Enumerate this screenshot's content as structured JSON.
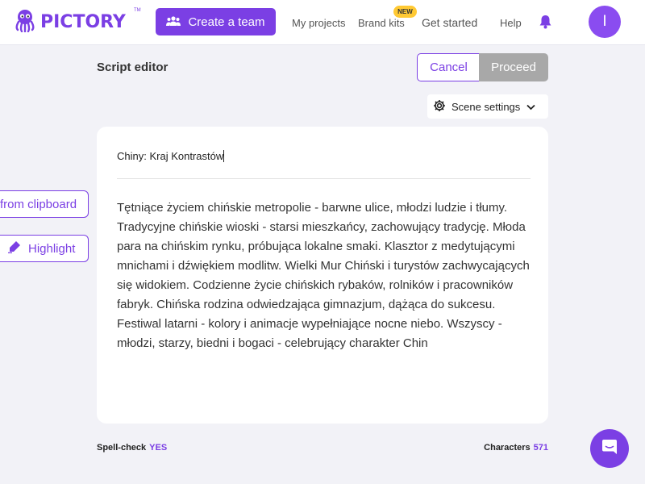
{
  "nav": {
    "logo_text": "PICTORY",
    "logo_tm": "TM",
    "create_team_label": "Create a team",
    "links": {
      "my_projects": "My projects",
      "brand_kits": "Brand kits",
      "get_started": "Get started",
      "help": "Help"
    },
    "new_badge": "NEW",
    "avatar_initial": "I"
  },
  "editor": {
    "page_title": "Script editor",
    "cancel_label": "Cancel",
    "proceed_label": "Proceed",
    "scene_settings_label": "Scene settings",
    "script_title": "Chiny: Kraj Kontrastów",
    "script_body": "Tętniące życiem chińskie metropolie - barwne ulice, młodzi ludzie i tłumy. Tradycyjne chińskie wioski - starsi mieszkańcy, zachowujący tradycję. Młoda para na chińskim rynku, próbująca lokalne smaki. Klasztor z medytującymi mnichami i dźwiękiem modlitw. Wielki Mur Chiński i turystów zachwycających się widokiem. Codzienne życie chińskich rybaków, rolników i pracowników fabryk. Chińska rodzina odwiedzająca gimnazjum, dążąca do sukcesu. Festiwal latarni - kolory i animacje wypełniające nocne niebo. Wszyscy - młodzi, starzy, biedni i bogaci - celebrujący charakter Chin"
  },
  "side": {
    "clipboard_label": "from clipboard",
    "highlight_label": "Highlight"
  },
  "footer": {
    "spellcheck_label": "Spell-check",
    "spellcheck_value": "YES",
    "characters_label": "Characters",
    "characters_value": "571"
  },
  "colors": {
    "accent": "#7b3fe4",
    "proceed_disabled": "#a8a8a8",
    "badge": "#ffc933",
    "background": "#f2f2f7"
  },
  "icons": [
    "octopus-logo-icon",
    "team-icon",
    "bell-icon",
    "gear-icon",
    "chevron-down-icon",
    "highlighter-icon",
    "chat-icon"
  ]
}
